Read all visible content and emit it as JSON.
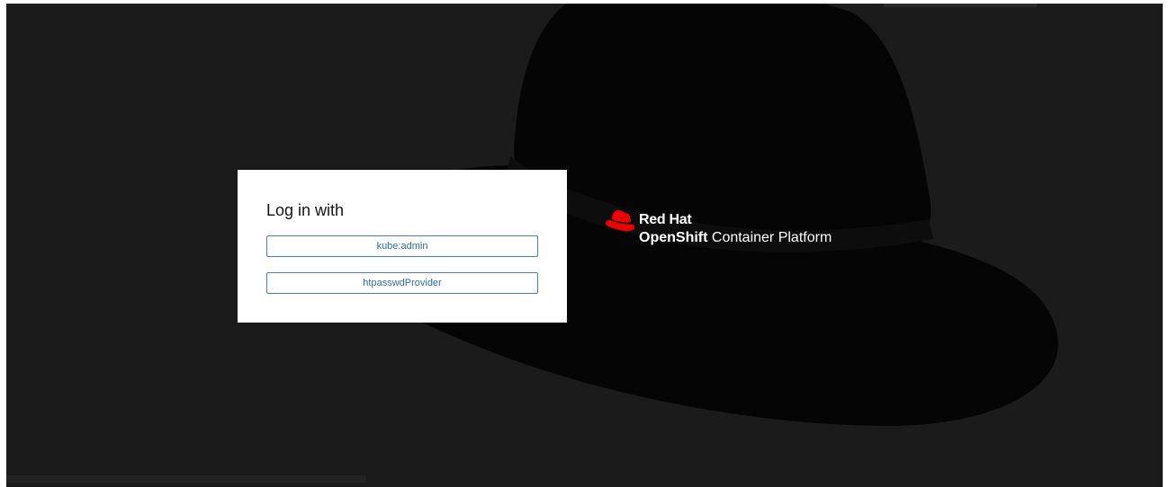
{
  "login": {
    "title": "Log in with",
    "providers": [
      {
        "label": "kube:admin"
      },
      {
        "label": "htpasswdProvider"
      }
    ]
  },
  "brand": {
    "company": "Red Hat",
    "product_strong": "OpenShift",
    "product_rest": " Container Platform",
    "logo_icon": "redhat-fedora-icon",
    "logo_color": "#ee0000"
  },
  "colors": {
    "background": "#1b1b1b",
    "hat": "#050505",
    "card": "#ffffff",
    "button_border": "#4a7fb0",
    "button_text": "#2b6cb0"
  }
}
